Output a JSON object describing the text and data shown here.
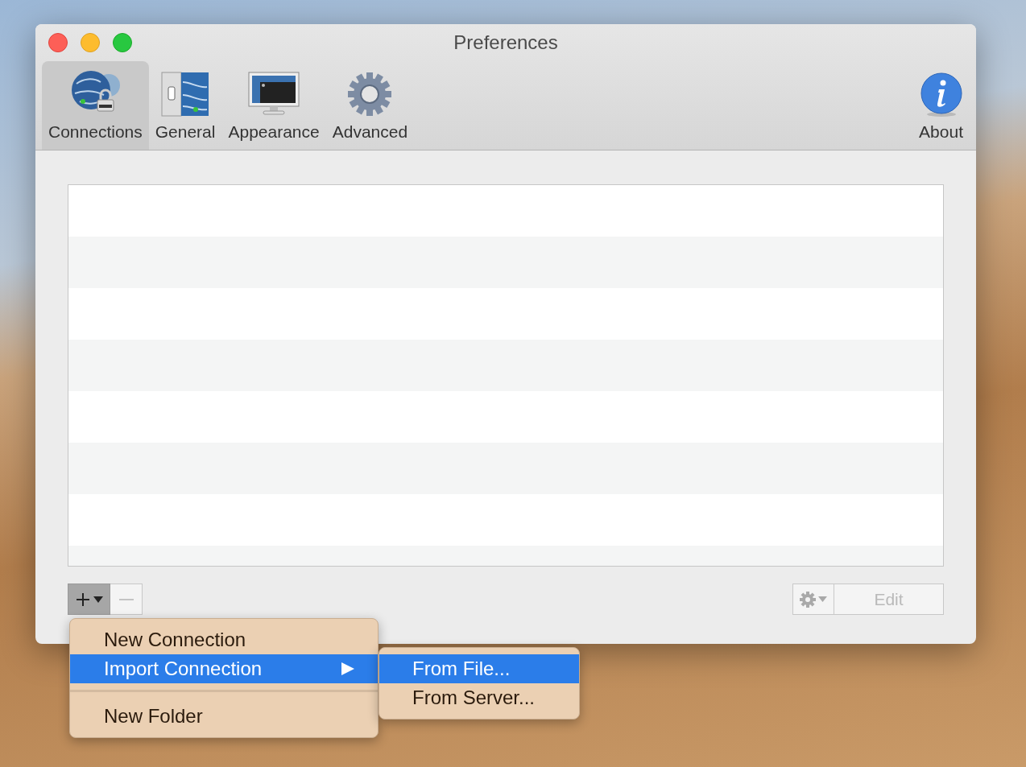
{
  "window": {
    "title": "Preferences"
  },
  "toolbar": {
    "tabs": [
      {
        "label": "Connections",
        "kind": "globe",
        "selected": true
      },
      {
        "label": "General",
        "kind": "switch",
        "selected": false
      },
      {
        "label": "Appearance",
        "kind": "monitor",
        "selected": false
      },
      {
        "label": "Advanced",
        "kind": "gear",
        "selected": false
      }
    ],
    "about": {
      "label": "About",
      "selected": false
    }
  },
  "list_buttons": {
    "add": {
      "pressed": true
    },
    "remove": {
      "disabled": true
    }
  },
  "action_buttons": {
    "action": {
      "disabled": true
    },
    "edit": {
      "label": "Edit",
      "disabled": true
    }
  },
  "menu": {
    "items": [
      {
        "kind": "item",
        "label": "New Connection",
        "selected": false,
        "submenu": false
      },
      {
        "kind": "item",
        "label": "Import Connection",
        "selected": true,
        "submenu": true
      },
      {
        "kind": "separator"
      },
      {
        "kind": "item",
        "label": "New Folder",
        "selected": false,
        "submenu": false
      }
    ]
  },
  "submenu": {
    "items": [
      {
        "label": "From File...",
        "selected": true
      },
      {
        "label": "From Server...",
        "selected": false
      }
    ]
  }
}
